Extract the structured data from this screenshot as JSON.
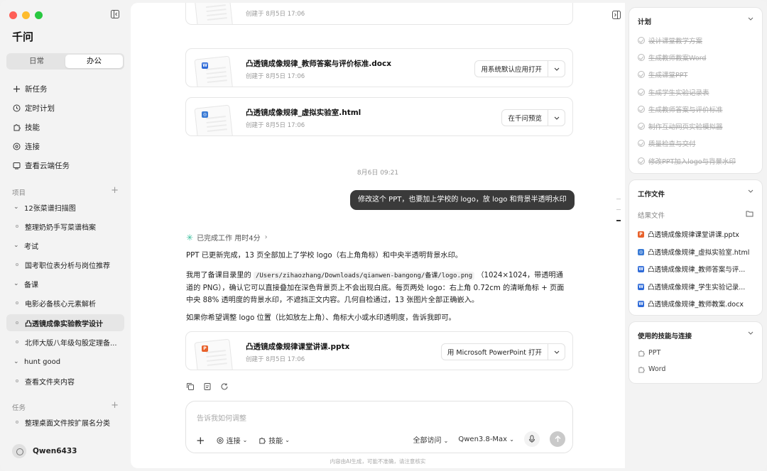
{
  "app": {
    "title": "千问",
    "colors": {
      "pptx": "#e8622c",
      "docx": "#2f6bd8",
      "html": "#3a7bd5",
      "accent": "#3dbf9e"
    }
  },
  "sidebar": {
    "tabs": [
      {
        "label": "日常"
      },
      {
        "label": "办公"
      }
    ],
    "nav": [
      {
        "label": "新任务",
        "icon": "plus-icon"
      },
      {
        "label": "定时计划",
        "icon": "clock-icon"
      },
      {
        "label": "技能",
        "icon": "puzzle-icon"
      },
      {
        "label": "连接",
        "icon": "link-icon"
      },
      {
        "label": "查看云端任务",
        "icon": "cloud-task-icon"
      }
    ],
    "projects_label": "项目",
    "projects": [
      {
        "label": "12张菜谱扫描图",
        "kind": "folder"
      },
      {
        "label": "整理奶奶手写菜谱档案",
        "kind": "task"
      },
      {
        "label": "考试",
        "kind": "folder"
      },
      {
        "label": "国考职位表分析与岗位推荐",
        "kind": "task"
      },
      {
        "label": "备课",
        "kind": "folder"
      },
      {
        "label": "电影必备核心元素解析",
        "kind": "task"
      },
      {
        "label": "凸透镜成像实验教学设计",
        "kind": "task"
      },
      {
        "label": "北师大版八年级勾股定理备...",
        "kind": "task"
      },
      {
        "label": "hunt good",
        "kind": "folder"
      },
      {
        "label": "查看文件夹内容",
        "kind": "task"
      }
    ],
    "tasks_label": "任务",
    "tasks": [
      {
        "label": "整理桌面文件按扩展名分类"
      }
    ],
    "user": "Qwen6433"
  },
  "chat": {
    "cards": [
      {
        "name": "凸透镜成像规律_教师答案与评价标准.docx",
        "meta": "创建于 8月5日 17:06",
        "badge": "W",
        "open": "用系统默认应用打开"
      },
      {
        "name": "凸透镜成像规律_虚拟实验室.html",
        "meta": "创建于 8月5日 17:06",
        "badge": "◎",
        "open": "在千问预览"
      }
    ],
    "partial_meta": "创建于 8月5日 17:06",
    "date": "8月6日 09:21",
    "user_msg": "修改这个 PPT，也要加上学校的 logo，放 logo 和背景半透明水印",
    "done": "已完成工作 用时4分",
    "p1": "PPT 已更新完成，13 页全部加上了学校 logo（右上角角标）和中央半透明背景水印。",
    "p2_a": "我用了备课目录里的",
    "p2_code": "/Users/zihaozhang/Downloads/qianwen-bangong/备课/logo.png",
    "p2_b": "（1024×1024，带透明通道的 PNG），确认它可以直接叠加在深色背景页上不会出现白底。每页两处 logo：右上角 0.72cm 的清晰角标 + 页面中央 88% 透明度的背景水印，不遮挡正文内容。几何自检通过，13 张图片全部正确嵌入。",
    "p3": "如果你希望调整 logo 位置（比如放左上角）、角标大小或水印透明度，告诉我即可。",
    "result_card": {
      "name": "凸透镜成像规律课堂讲课.pptx",
      "meta": "创建于 8月5日 17:06",
      "badge": "P",
      "open": "用 Microsoft PowerPoint 打开"
    }
  },
  "composer": {
    "placeholder": "告诉我如何调整",
    "connect": "连接",
    "skills": "技能",
    "access": "全部访问",
    "model": "Qwen3.8-Max"
  },
  "footnote": "内容由AI生成，可能不准确，请注意核实",
  "panel": {
    "plan_title": "计划",
    "plan": [
      "设计课堂教学方案",
      "生成教师教案Word",
      "生成课堂PPT",
      "生成学生实验记录表",
      "生成教师答案与评价标准",
      "制作互动网页实验模拟器",
      "质量检查与交付",
      "修改PPT加入logo与背景水印"
    ],
    "files_title": "工作文件",
    "results_label": "结果文件",
    "files": [
      {
        "name": "凸透镜成像规律课堂讲课.pptx",
        "badge": "P",
        "type": "pptx"
      },
      {
        "name": "凸透镜成像规律_虚拟实验室.html",
        "badge": "◎",
        "type": "html"
      },
      {
        "name": "凸透镜成像规律_教师答案与评...",
        "badge": "W",
        "type": "docx"
      },
      {
        "name": "凸透镜成像规律_学生实验记录...",
        "badge": "W",
        "type": "docx"
      },
      {
        "name": "凸透镜成像规律_教师教案.docx",
        "badge": "W",
        "type": "docx"
      }
    ],
    "skills_title": "使用的技能与连接",
    "skills": [
      "PPT",
      "Word"
    ]
  }
}
